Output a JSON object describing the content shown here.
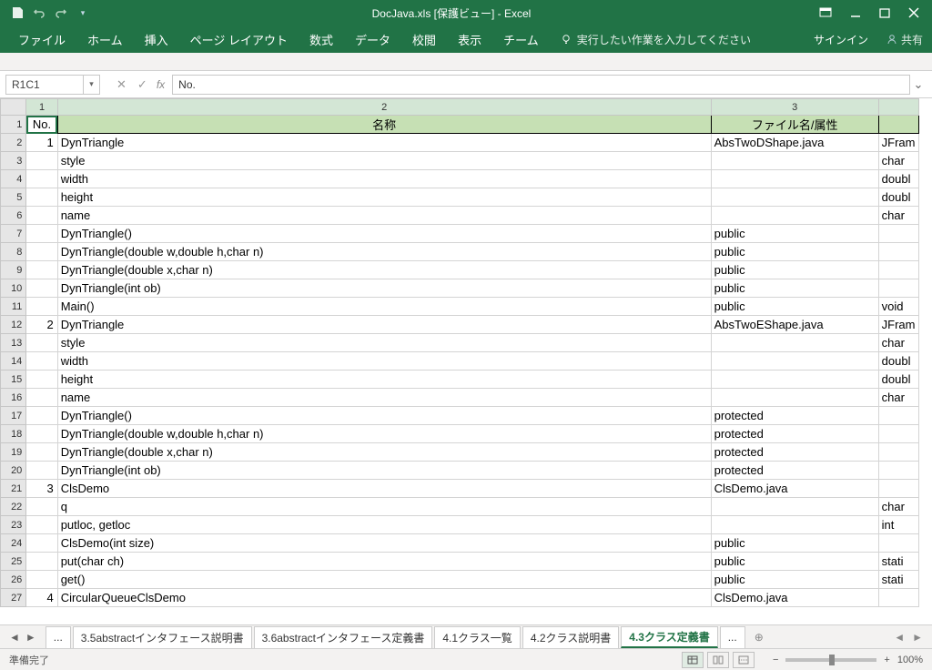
{
  "titlebar": {
    "title": "DocJava.xls  [保護ビュー] - Excel"
  },
  "ribbon": {
    "tabs": [
      "ファイル",
      "ホーム",
      "挿入",
      "ページ レイアウト",
      "数式",
      "データ",
      "校閲",
      "表示",
      "チーム"
    ],
    "tellme": "実行したい作業を入力してください",
    "signin": "サインイン",
    "share": "共有"
  },
  "formula_bar": {
    "name_box": "R1C1",
    "fx": "fx",
    "value": "No."
  },
  "columns": {
    "labels": [
      "1",
      "2",
      "3"
    ]
  },
  "headers": {
    "c1": "No.",
    "c2": "名称",
    "c3": "ファイル名/属性"
  },
  "rows": [
    {
      "r": "2",
      "no": "1",
      "name": "DynTriangle",
      "file": "AbsTwoDShape.java",
      "t": "JFram",
      "tb": true
    },
    {
      "r": "3",
      "no": "",
      "name": "style",
      "file": "",
      "t": "char"
    },
    {
      "r": "4",
      "no": "",
      "name": "width",
      "file": "",
      "t": "doubl"
    },
    {
      "r": "5",
      "no": "",
      "name": "height",
      "file": "",
      "t": "doubl"
    },
    {
      "r": "6",
      "no": "",
      "name": "name",
      "file": "",
      "t": "char"
    },
    {
      "r": "7",
      "no": "",
      "name": "DynTriangle()",
      "file": "public",
      "t": ""
    },
    {
      "r": "8",
      "no": "",
      "name": "DynTriangle(double w,double h,char n)",
      "file": "public",
      "t": ""
    },
    {
      "r": "9",
      "no": "",
      "name": "DynTriangle(double x,char n)",
      "file": "public",
      "t": ""
    },
    {
      "r": "10",
      "no": "",
      "name": "DynTriangle(int ob)",
      "file": "public",
      "t": ""
    },
    {
      "r": "11",
      "no": "",
      "name": "Main()",
      "file": "public",
      "t": "void"
    },
    {
      "r": "12",
      "no": "2",
      "name": "DynTriangle",
      "file": "AbsTwoEShape.java",
      "t": "JFram",
      "tb": true
    },
    {
      "r": "13",
      "no": "",
      "name": "style",
      "file": "",
      "t": "char"
    },
    {
      "r": "14",
      "no": "",
      "name": "width",
      "file": "",
      "t": "doubl"
    },
    {
      "r": "15",
      "no": "",
      "name": "height",
      "file": "",
      "t": "doubl"
    },
    {
      "r": "16",
      "no": "",
      "name": "name",
      "file": "",
      "t": "char"
    },
    {
      "r": "17",
      "no": "",
      "name": "DynTriangle()",
      "file": "protected",
      "t": ""
    },
    {
      "r": "18",
      "no": "",
      "name": "DynTriangle(double w,double h,char n)",
      "file": "protected",
      "t": ""
    },
    {
      "r": "19",
      "no": "",
      "name": "DynTriangle(double x,char n)",
      "file": "protected",
      "t": ""
    },
    {
      "r": "20",
      "no": "",
      "name": "DynTriangle(int ob)",
      "file": "protected",
      "t": ""
    },
    {
      "r": "21",
      "no": "3",
      "name": "ClsDemo",
      "file": "ClsDemo.java",
      "t": "",
      "tb": true
    },
    {
      "r": "22",
      "no": "",
      "name": "q",
      "file": "",
      "t": "char"
    },
    {
      "r": "23",
      "no": "",
      "name": "putloc, getloc",
      "file": "",
      "t": "int"
    },
    {
      "r": "24",
      "no": "",
      "name": "ClsDemo(int size)",
      "file": "public",
      "t": ""
    },
    {
      "r": "25",
      "no": "",
      "name": "put(char ch)",
      "file": "public",
      "t": "stati"
    },
    {
      "r": "26",
      "no": "",
      "name": "get()",
      "file": "public",
      "t": "stati"
    },
    {
      "r": "27",
      "no": "4",
      "name": "CircularQueueClsDemo",
      "file": "ClsDemo.java",
      "t": "",
      "tb": true
    }
  ],
  "sheets": {
    "ellipsis": "...",
    "tabs": [
      "3.5abstractインタフェース説明書",
      "3.6abstractインタフェース定義書",
      "4.1クラス一覧",
      "4.2クラス説明書",
      "4.3クラス定義書"
    ],
    "active": 4
  },
  "statusbar": {
    "ready": "準備完了",
    "zoom": "100%"
  }
}
